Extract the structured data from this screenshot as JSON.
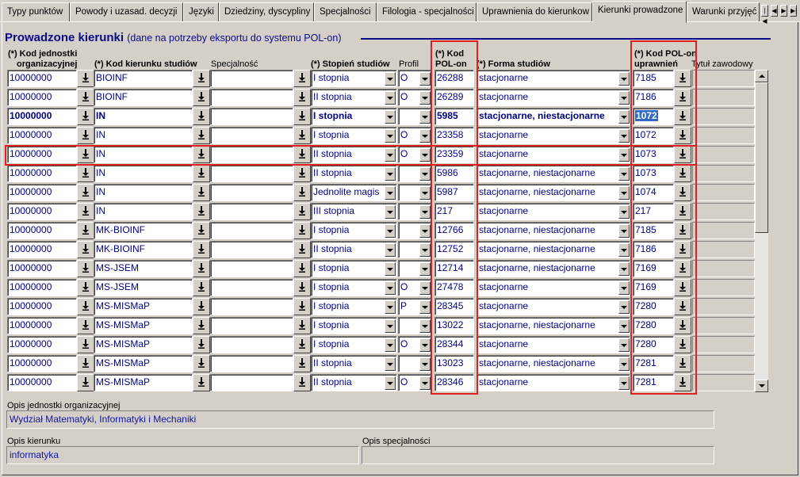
{
  "tabs": [
    {
      "label": "Typy punktów",
      "active": false
    },
    {
      "label": "Powody i uzasad. decyzji",
      "active": false
    },
    {
      "label": "Języki",
      "active": false
    },
    {
      "label": "Dziedziny, dyscypliny",
      "active": false
    },
    {
      "label": "Specjalności",
      "active": false
    },
    {
      "label": "Filologia - specjalności",
      "active": false
    },
    {
      "label": "Uprawnienia do kierunkow",
      "active": false
    },
    {
      "label": "Kierunki prowadzone",
      "active": true
    },
    {
      "label": "Warunki przyjęć",
      "active": false
    }
  ],
  "tab_scroll_icons": [
    "first-icon",
    "prev-icon",
    "next-icon",
    "last-icon"
  ],
  "title": {
    "main": "Prowadzone kierunki",
    "sub": "(dane na potrzeby eksportu do systemu POL-on)"
  },
  "headers": {
    "unit_line1": "(*) Kod jednostki",
    "unit_line2": "organizacyjnej",
    "program": "(*) Kod kierunku studiów",
    "specialty": "Specjalność",
    "degree": "(*) Stopień studiów",
    "profile": "Profil",
    "polon_line1": "(*) Kod",
    "polon_line2": "POL-on",
    "form": "(*) Forma studiów",
    "polon_perm_line1": "(*) Kod POL-on",
    "polon_perm_line2": "uprawnień",
    "title": "Tytuł zawodowy"
  },
  "rows": [
    {
      "unit": "10000000",
      "program": "BIOINF",
      "specialty": "",
      "degree": "I stopnia",
      "profile": "O",
      "polon": "26288",
      "form": "stacjonarne",
      "perm": "7185",
      "current": false
    },
    {
      "unit": "10000000",
      "program": "BIOINF",
      "specialty": "",
      "degree": "II stopnia",
      "profile": "O",
      "polon": "26289",
      "form": "stacjonarne",
      "perm": "7186",
      "current": false
    },
    {
      "unit": "10000000",
      "program": "IN",
      "specialty": "",
      "degree": "I stopnia",
      "profile": "",
      "polon": "5985",
      "form": "stacjonarne, niestacjonarne",
      "perm": "1072",
      "current": true
    },
    {
      "unit": "10000000",
      "program": "IN",
      "specialty": "",
      "degree": "I stopnia",
      "profile": "O",
      "polon": "23358",
      "form": "stacjonarne",
      "perm": "1072",
      "current": false
    },
    {
      "unit": "10000000",
      "program": "IN",
      "specialty": "",
      "degree": "II stopnia",
      "profile": "O",
      "polon": "23359",
      "form": "stacjonarne",
      "perm": "1073",
      "current": false
    },
    {
      "unit": "10000000",
      "program": "IN",
      "specialty": "",
      "degree": "II stopnia",
      "profile": "",
      "polon": "5986",
      "form": "stacjonarne, niestacjonarne",
      "perm": "1073",
      "current": false
    },
    {
      "unit": "10000000",
      "program": "IN",
      "specialty": "",
      "degree": "Jednolite magis",
      "profile": "",
      "polon": "5987",
      "form": "stacjonarne, niestacjonarne",
      "perm": "1074",
      "current": false
    },
    {
      "unit": "10000000",
      "program": "IN",
      "specialty": "",
      "degree": "III stopnia",
      "profile": "",
      "polon": "217",
      "form": "stacjonarne",
      "perm": "217",
      "current": false
    },
    {
      "unit": "10000000",
      "program": "MK-BIOINF",
      "specialty": "",
      "degree": "I stopnia",
      "profile": "",
      "polon": "12766",
      "form": "stacjonarne, niestacjonarne",
      "perm": "7185",
      "current": false
    },
    {
      "unit": "10000000",
      "program": "MK-BIOINF",
      "specialty": "",
      "degree": "II stopnia",
      "profile": "",
      "polon": "12752",
      "form": "stacjonarne, niestacjonarne",
      "perm": "7186",
      "current": false
    },
    {
      "unit": "10000000",
      "program": "MS-JSEM",
      "specialty": "",
      "degree": "I stopnia",
      "profile": "",
      "polon": "12714",
      "form": "stacjonarne, niestacjonarne",
      "perm": "7169",
      "current": false
    },
    {
      "unit": "10000000",
      "program": "MS-JSEM",
      "specialty": "",
      "degree": "I stopnia",
      "profile": "O",
      "polon": "27478",
      "form": "stacjonarne",
      "perm": "7169",
      "current": false
    },
    {
      "unit": "10000000",
      "program": "MS-MISMaP",
      "specialty": "",
      "degree": "I stopnia",
      "profile": "P",
      "polon": "28345",
      "form": "stacjonarne",
      "perm": "7280",
      "current": false
    },
    {
      "unit": "10000000",
      "program": "MS-MISMaP",
      "specialty": "",
      "degree": "I stopnia",
      "profile": "",
      "polon": "13022",
      "form": "stacjonarne, niestacjonarne",
      "perm": "7280",
      "current": false
    },
    {
      "unit": "10000000",
      "program": "MS-MISMaP",
      "specialty": "",
      "degree": "I stopnia",
      "profile": "O",
      "polon": "28344",
      "form": "stacjonarne",
      "perm": "7280",
      "current": false
    },
    {
      "unit": "10000000",
      "program": "MS-MISMaP",
      "specialty": "",
      "degree": "II stopnia",
      "profile": "",
      "polon": "13023",
      "form": "stacjonarne, niestacjonarne",
      "perm": "7281",
      "current": false
    },
    {
      "unit": "10000000",
      "program": "MS-MISMaP",
      "specialty": "",
      "degree": "II stopnia",
      "profile": "O",
      "polon": "28346",
      "form": "stacjonarne",
      "perm": "7281",
      "current": false
    }
  ],
  "footer": {
    "unit_desc_label": "Opis jednostki organizacyjnej",
    "unit_desc_value": "Wydział Matematyki, Informatyki i Mechaniki",
    "program_desc_label": "Opis kierunku",
    "program_desc_value": "informatyka",
    "specialty_desc_label": "Opis specjalności",
    "specialty_desc_value": ""
  },
  "colors": {
    "highlight_box": "#e02020",
    "title": "#0a0a8a",
    "value_text": "#00008b",
    "selection": "#316ac5"
  }
}
